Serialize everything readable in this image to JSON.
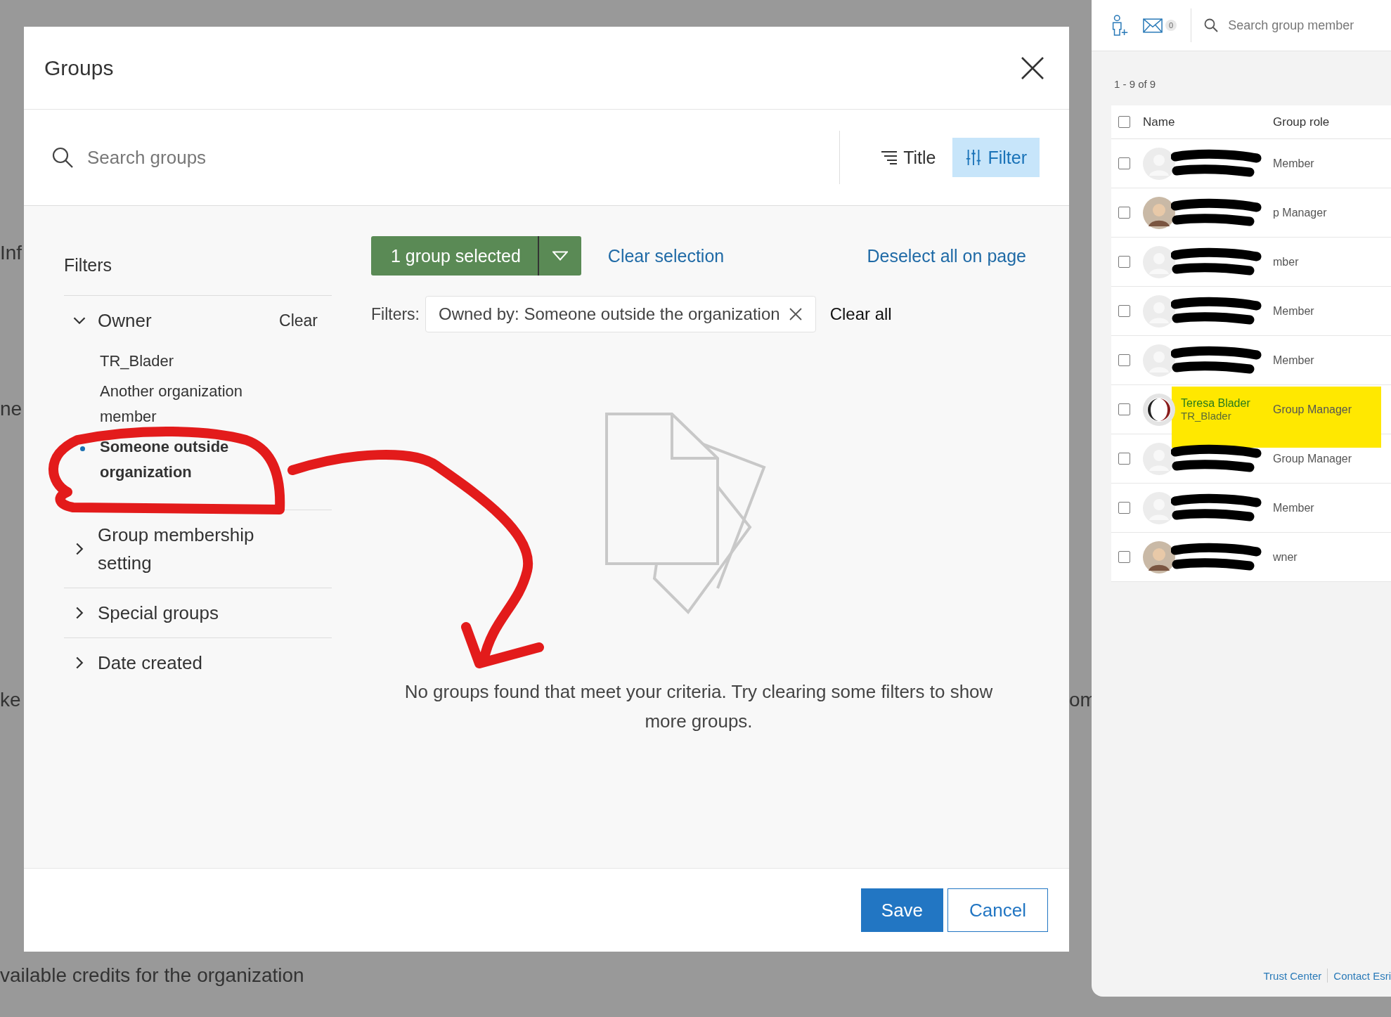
{
  "background": {
    "fragments": [
      "Inf",
      "ne",
      "ke",
      "om"
    ],
    "text": "vailable credits for the organization"
  },
  "dialog": {
    "title": "Groups",
    "search": {
      "placeholder": "Search groups"
    },
    "sort_button": "Title",
    "filter_button": {
      "label": "Filter",
      "selected": true
    },
    "selection_button": "1 group selected",
    "clear_selection": "Clear selection",
    "deselect_all": "Deselect all on page",
    "filters_label": "Filters:",
    "active_filters": [
      {
        "label": "Owned by: Someone outside the organization"
      }
    ],
    "clear_all": "Clear all",
    "sidebar": {
      "title": "Filters",
      "sections": [
        {
          "label": "Owner",
          "expanded": true,
          "action": "Clear",
          "options": [
            {
              "lines": [
                "TR_Blader"
              ],
              "selected": false
            },
            {
              "lines": [
                "Another organization",
                "member"
              ],
              "selected": false
            },
            {
              "lines": [
                "Someone outside",
                "organization"
              ],
              "selected": true
            }
          ]
        },
        {
          "label": "Group membership setting",
          "expanded": false
        },
        {
          "label": "Special groups",
          "expanded": false
        },
        {
          "label": "Date created",
          "expanded": false
        }
      ]
    },
    "empty_message": "No groups found that meet your criteria. Try clearing some filters to show more groups.",
    "buttons": [
      {
        "label": "Save",
        "kind": "primary"
      },
      {
        "label": "Cancel",
        "kind": "secondary"
      }
    ]
  },
  "member_panel": {
    "message_count": "0",
    "search_placeholder": "Search group member",
    "range": "1 - 9 of 9",
    "select_all_checked": false,
    "columns": [
      "Name",
      "Group role"
    ],
    "members": [
      {
        "avatar": {
          "kind": "placeholder"
        },
        "name_redacted": true,
        "role": "Member",
        "checked": false
      },
      {
        "avatar": {
          "kind": "photo"
        },
        "name_redacted": true,
        "role": "p Manager",
        "checked": false
      },
      {
        "avatar": {
          "kind": "placeholder"
        },
        "name_redacted": true,
        "role": "mber",
        "checked": false
      },
      {
        "avatar": {
          "kind": "placeholder"
        },
        "name_redacted": true,
        "role": "Member",
        "checked": false
      },
      {
        "avatar": {
          "kind": "placeholder"
        },
        "name_redacted": true,
        "role": "Member",
        "checked": false
      },
      {
        "avatar": {
          "kind": "logo"
        },
        "name": "Teresa Blader",
        "username": "TR_Blader",
        "role": "Group Manager",
        "checked": false,
        "highlighted": true
      },
      {
        "avatar": {
          "kind": "placeholder"
        },
        "name_redacted": true,
        "role": "Group Manager",
        "checked": false
      },
      {
        "avatar": {
          "kind": "placeholder"
        },
        "name_redacted": true,
        "role": "Member",
        "checked": false
      },
      {
        "avatar": {
          "kind": "photo"
        },
        "name_redacted": true,
        "role": "wner",
        "checked": false
      }
    ],
    "footer_links": [
      "Trust Center",
      "Contact Esri"
    ]
  }
}
